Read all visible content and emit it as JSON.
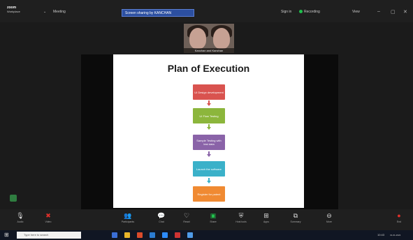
{
  "app": {
    "brand_line1": "zoom",
    "brand_line2": "Workplace",
    "meeting_label": "Meeting",
    "share_tab": "Screen sharing by KANCHAN",
    "signin": "Sign in",
    "recording": "Recording",
    "view": "View",
    "minimize": "–",
    "restore": "▢",
    "close": "✕"
  },
  "video": {
    "name": "Kanchan and Kanchan"
  },
  "slide": {
    "title": "Plan of Execution",
    "steps": [
      {
        "label": "UI Design development",
        "color": "#d9534f"
      },
      {
        "label": "UI Flow Testing",
        "color": "#8cb63c"
      },
      {
        "label": "Sample Testing with test data",
        "color": "#8a63a8"
      },
      {
        "label": "Launch the software",
        "color": "#3bb1c9"
      },
      {
        "label": "Register for patent",
        "color": "#f08a32"
      }
    ]
  },
  "toolbar": {
    "audio": "Audio",
    "video": "Video",
    "participants": "Participants",
    "chat": "Chat",
    "react": "React",
    "share": "Share",
    "host_tools": "Host tools",
    "apps": "Apps",
    "summary": "Summary",
    "more": "More",
    "end": "End"
  },
  "taskbar": {
    "search_placeholder": "Type here to search",
    "time": "10:43",
    "date": "31-01-2024"
  }
}
